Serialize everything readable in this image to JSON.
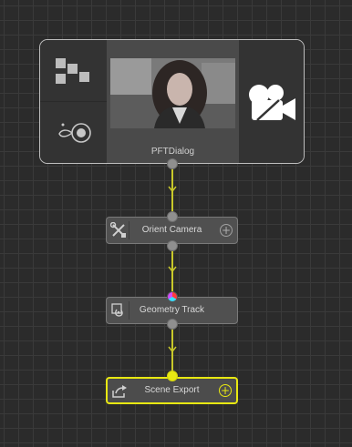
{
  "graph": {
    "source_node": {
      "title": "PFTDialog",
      "left_icons": [
        "blocks-icon",
        "tracker-target-icon"
      ],
      "right_icon": "movie-camera-icon",
      "thumbnail": "preview-thumbnail"
    },
    "nodes": [
      {
        "label": "Orient Camera",
        "icon": "tools-icon",
        "action": "+"
      },
      {
        "label": "Geometry Track",
        "icon": "geometry-track-icon",
        "action": ""
      },
      {
        "label": "Scene Export",
        "icon": "export-icon",
        "action": "+"
      }
    ]
  },
  "colors": {
    "wire": "#c8c82a",
    "selected": "#e8e812",
    "background": "#2b2b2b"
  }
}
